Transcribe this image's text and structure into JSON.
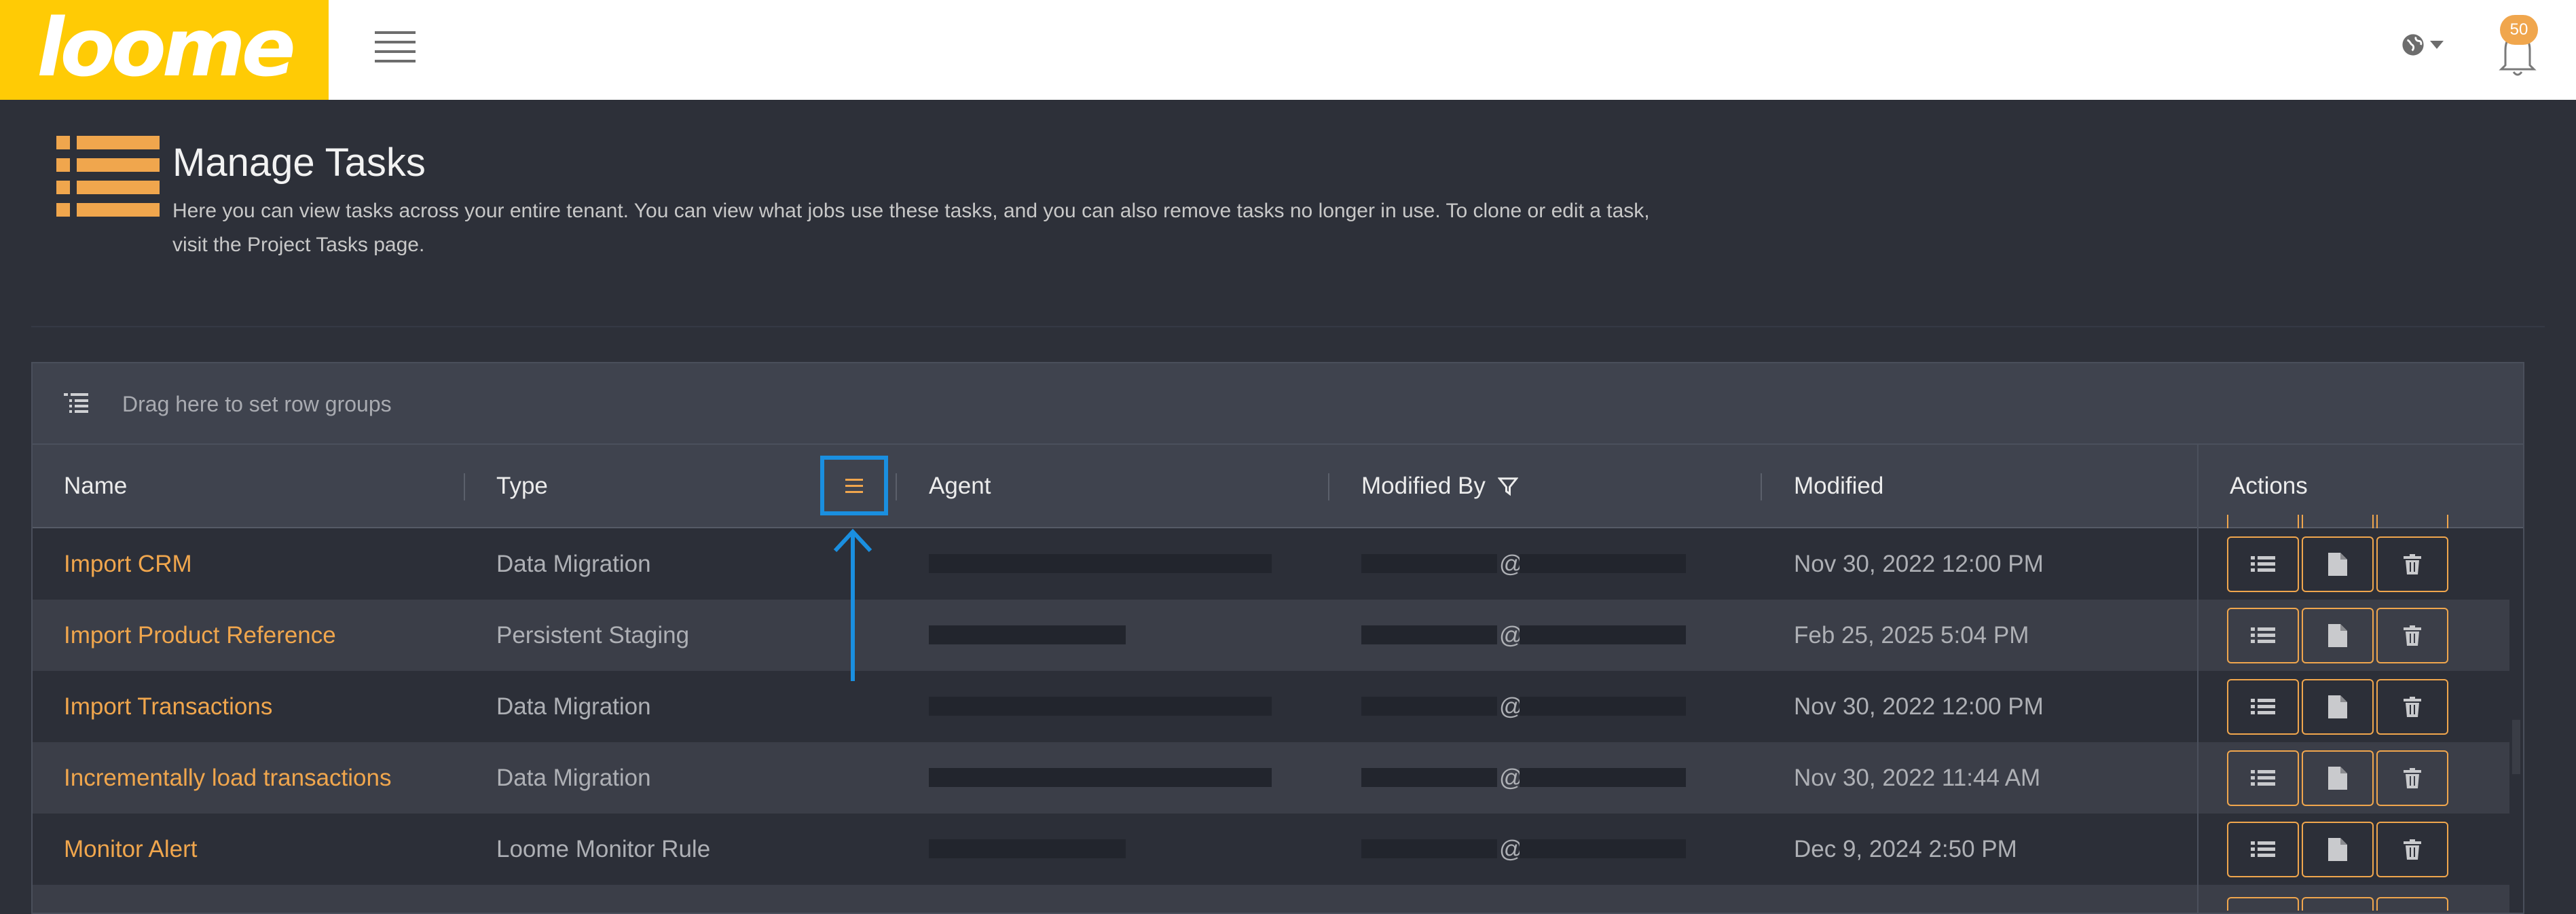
{
  "app": {
    "logo_text": "loome",
    "brand_color": "#ffcb05"
  },
  "header": {
    "notification_count": "50",
    "globe_icon": "globe-icon",
    "bell_icon": "bell-icon"
  },
  "page": {
    "title": "Manage Tasks",
    "description_line1": "Here you can view tasks across your entire tenant. You can view what jobs use these tasks, and you can also remove tasks no longer in use. To clone or edit a task,",
    "description_line2": "visit the Project Tasks page."
  },
  "grid": {
    "group_placeholder": "Drag here to set row groups",
    "columns": [
      "Name",
      "Type",
      "Agent",
      "Modified By",
      "Modified",
      "Actions"
    ],
    "rows": [
      {
        "name": "Import CRM",
        "type": "Data Migration",
        "modified_by_symbol": "@",
        "modified": "Nov 30, 2022 12:00 PM"
      },
      {
        "name": "Import Product Reference",
        "type": "Persistent Staging",
        "modified_by_symbol": "@",
        "modified": "Feb 25, 2025 5:04 PM"
      },
      {
        "name": "Import Transactions",
        "type": "Data Migration",
        "modified_by_symbol": "@",
        "modified": "Nov 30, 2022 12:00 PM"
      },
      {
        "name": "Incrementally load transactions",
        "type": "Data Migration",
        "modified_by_symbol": "@",
        "modified": "Nov 30, 2022 11:44 AM"
      },
      {
        "name": "Monitor Alert",
        "type": "Loome Monitor Rule",
        "modified_by_symbol": "@",
        "modified": "Dec 9, 2024 2:50 PM"
      }
    ],
    "action_icons": [
      "list-icon",
      "document-icon",
      "trash-icon"
    ]
  },
  "colors": {
    "accent": "#f0a64d",
    "highlight": "#1a8fe0",
    "background": "#2d3039"
  }
}
